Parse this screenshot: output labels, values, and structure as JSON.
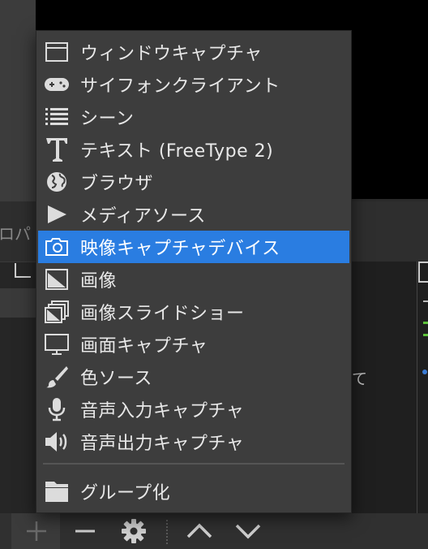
{
  "background": {
    "dock_title": "ロパ",
    "truncated_text": "て"
  },
  "menu": {
    "items": [
      {
        "label": "ウィンドウキャプチャ",
        "icon": "window-icon"
      },
      {
        "label": "サイフォンクライアント",
        "icon": "gamepad-icon"
      },
      {
        "label": "シーン",
        "icon": "list-icon"
      },
      {
        "label": "テキスト (FreeType 2)",
        "icon": "text-icon"
      },
      {
        "label": "ブラウザ",
        "icon": "globe-icon"
      },
      {
        "label": "メディアソース",
        "icon": "play-icon"
      },
      {
        "label": "映像キャプチャデバイス",
        "icon": "camera-icon",
        "selected": true
      },
      {
        "label": "画像",
        "icon": "image-icon"
      },
      {
        "label": "画像スライドショー",
        "icon": "slideshow-icon"
      },
      {
        "label": "画面キャプチャ",
        "icon": "monitor-icon"
      },
      {
        "label": "色ソース",
        "icon": "brush-icon"
      },
      {
        "label": "音声入力キャプチャ",
        "icon": "microphone-icon"
      },
      {
        "label": "音声出力キャプチャ",
        "icon": "speaker-icon"
      },
      {
        "label": "グループ化",
        "icon": "folder-icon"
      }
    ]
  },
  "toolbar": {
    "buttons": [
      "add-icon",
      "remove-icon",
      "gear-icon",
      "chevron-up-icon",
      "chevron-down-icon"
    ]
  },
  "colors": {
    "accent": "#2a7de1",
    "menu_bg": "#3d3d3d"
  }
}
